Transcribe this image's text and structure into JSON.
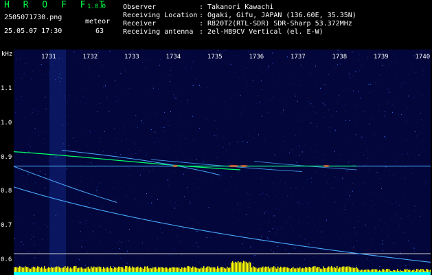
{
  "header": {
    "app_name": "H R O F F T",
    "version": "1.0.0",
    "filename": "2505071730.png",
    "datetime": "25.05.07 17:30",
    "meteor_label": "meteor",
    "meteor_count": "63",
    "info": [
      {
        "label": "Observer",
        "value": ": Takanori Kawachi"
      },
      {
        "label": "Receiving Location",
        "value": ": Ogaki, Gifu, JAPAN (136.60E, 35.35N)"
      },
      {
        "label": "Receiver",
        "value": ": R820T2(RTL-SDR) SDR-Sharp 53.372MHz"
      },
      {
        "label": "Receiving antenna",
        "value": ": 2el-HB9CV Vertical (el. E-W)"
      }
    ]
  },
  "chart_data": {
    "type": "heatmap",
    "y_unit_label": "kHz",
    "y_ticks": [
      "1.1",
      "1.0",
      "0.9",
      "0.8",
      "0.7",
      "0.6"
    ],
    "x_ticks": [
      "1731",
      "1732",
      "1733",
      "1734",
      "1735",
      "1736",
      "1737",
      "1738",
      "1739",
      "1740"
    ],
    "ylim": [
      0.59,
      1.2
    ],
    "carrier_khz": 0.876,
    "marker_khz": 0.62
  },
  "colors": {
    "background": "#02063a",
    "signal": "#4aa8ff",
    "meteor": "#00ff66",
    "hot": "#ff3030",
    "bars": "#ffff00",
    "base": "#00ffff",
    "header_green": "#00ff44"
  }
}
